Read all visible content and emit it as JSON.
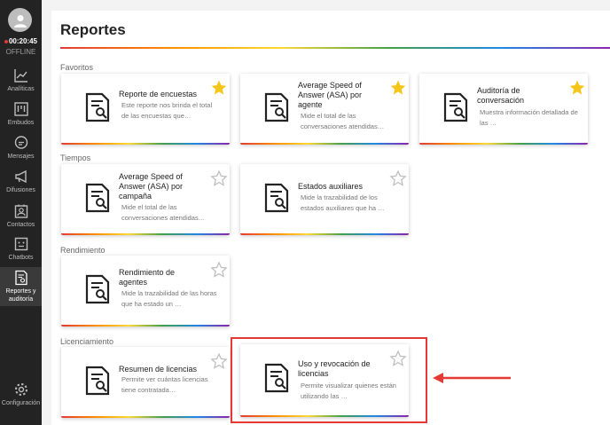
{
  "sidebar": {
    "timer": "00:20:45",
    "status": "OFFLINE",
    "items": [
      {
        "label": "Analíticas",
        "icon": "chart-icon"
      },
      {
        "label": "Embudos",
        "icon": "funnel-icon"
      },
      {
        "label": "Mensajes",
        "icon": "chat-icon"
      },
      {
        "label": "Difusiones",
        "icon": "megaphone-icon"
      },
      {
        "label": "Contactos",
        "icon": "contacts-icon"
      },
      {
        "label": "Chatbots",
        "icon": "bot-icon"
      },
      {
        "label": "Reportes y auditoría",
        "icon": "report-icon"
      },
      {
        "label": "Configuración",
        "icon": "gear-icon"
      }
    ]
  },
  "page": {
    "title": "Reportes"
  },
  "sections": {
    "favoritos": "Favoritos",
    "tiempos": "Tiempos",
    "rendimiento": "Rendimiento",
    "licenciamiento": "Licenciamiento"
  },
  "cards": {
    "encuestas": {
      "title": "Reporte de encuestas",
      "desc": "Este reporte nos brinda el total de las encuestas que…",
      "favorite": true
    },
    "asa_agente": {
      "title": "Average Speed of Answer (ASA) por agente",
      "desc": "Mide el total de las conversaciones atendidas…",
      "favorite": true
    },
    "auditoria": {
      "title": "Auditoría de conversación",
      "desc": "Muestra información detallada de las …",
      "favorite": true
    },
    "asa_campana": {
      "title": "Average Speed of Answer (ASA) por campaña",
      "desc": "Mide el total de las conversaciones atendidas…",
      "favorite": false
    },
    "estados": {
      "title": "Estados auxiliares",
      "desc": "Mide la trazabilidad de los estados auxiliares que ha …",
      "favorite": false
    },
    "rendimiento_agentes": {
      "title": "Rendimiento de agentes",
      "desc": "Mide la trazabilidad de las horas que ha estado un …",
      "favorite": false
    },
    "resumen_licencias": {
      "title": "Resumen de licencias",
      "desc": "Permite ver cuántas licencias tiene contratada…",
      "favorite": false
    },
    "uso_licencias": {
      "title": "Uso y revocación de licencias",
      "desc": "Permite visualizar quienes están utilizando las …",
      "favorite": false
    }
  },
  "colors": {
    "star_filled": "#f5c518",
    "star_empty": "#bdbdbd",
    "highlight": "#e53935",
    "sidebar_bg": "#232323"
  }
}
